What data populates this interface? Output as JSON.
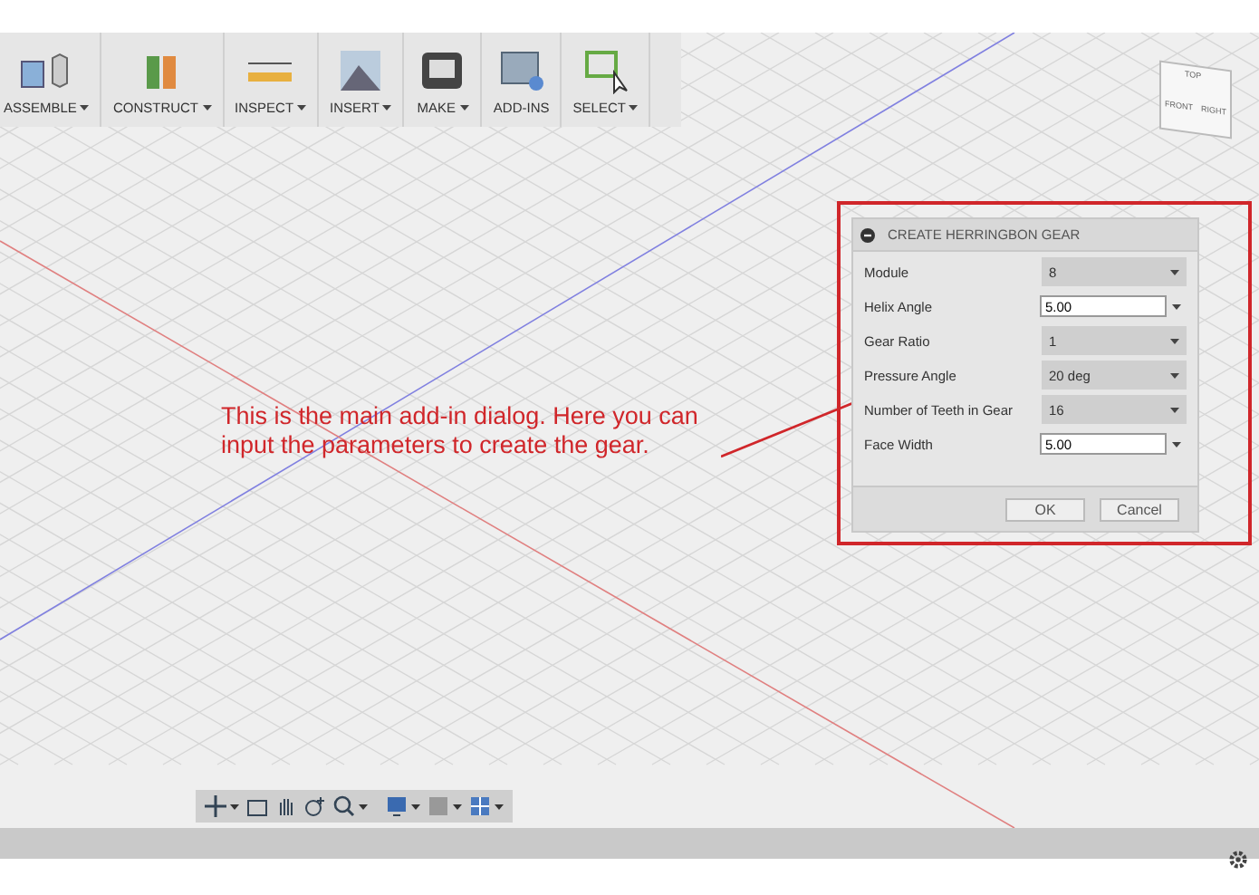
{
  "toolbar": {
    "groups": [
      {
        "label": "ASSEMBLE",
        "dropdown": true
      },
      {
        "label": "CONSTRUCT",
        "dropdown": true
      },
      {
        "label": "INSPECT",
        "dropdown": true
      },
      {
        "label": "INSERT",
        "dropdown": true
      },
      {
        "label": "MAKE",
        "dropdown": true
      },
      {
        "label": "ADD-INS",
        "dropdown": false
      },
      {
        "label": "SELECT",
        "dropdown": true
      }
    ]
  },
  "view_cube": {
    "top": "TOP",
    "front": "FRONT",
    "right": "RIGHT"
  },
  "annotation": {
    "text": "This is the main add-in dialog. Here you can input the parameters to create the gear."
  },
  "dialog": {
    "title": "CREATE HERRINGBON GEAR",
    "rows": [
      {
        "label": "Module",
        "kind": "select",
        "value": "8"
      },
      {
        "label": "Helix Angle",
        "kind": "input",
        "value": "5.00"
      },
      {
        "label": "Gear Ratio",
        "kind": "select",
        "value": "1"
      },
      {
        "label": "Pressure Angle",
        "kind": "select",
        "value": "20 deg"
      },
      {
        "label": "Number of Teeth in Gear",
        "kind": "select",
        "value": "16"
      },
      {
        "label": "Face Width",
        "kind": "input",
        "value": "5.00"
      }
    ],
    "buttons": [
      "OK",
      "Cancel"
    ]
  }
}
